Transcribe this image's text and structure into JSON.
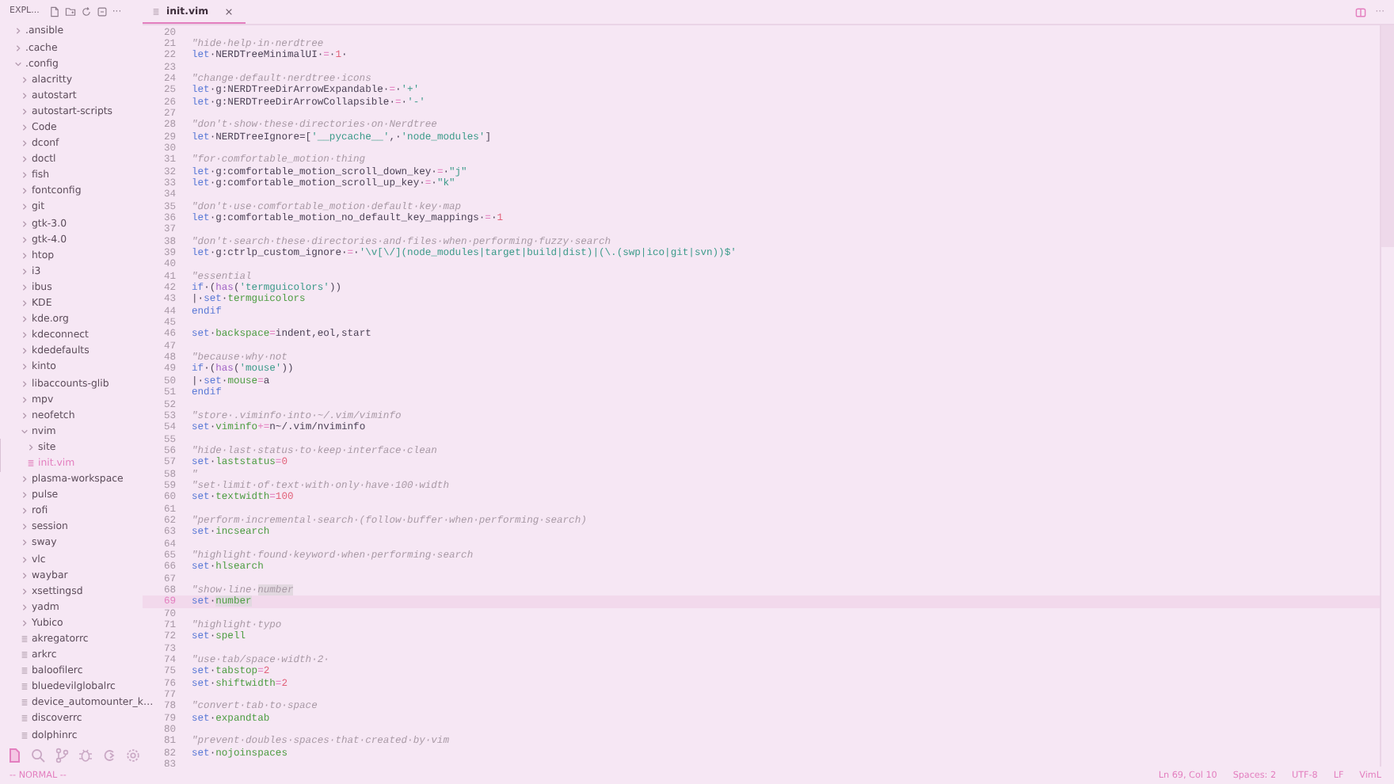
{
  "sidebar": {
    "title": "EXPL...",
    "more": "···",
    "tree": [
      {
        "label": ".ansible",
        "kind": "folder",
        "expanded": false,
        "selected": false
      },
      {
        "label": ".cache",
        "kind": "folder",
        "expanded": false,
        "selected": false
      },
      {
        "label": ".config",
        "kind": "folder",
        "expanded": true,
        "selected": false,
        "children": [
          {
            "label": "alacritty",
            "kind": "folder",
            "expanded": false,
            "selected": false
          },
          {
            "label": "autostart",
            "kind": "folder",
            "expanded": false,
            "selected": false
          },
          {
            "label": "autostart-scripts",
            "kind": "folder",
            "expanded": false,
            "selected": false
          },
          {
            "label": "Code",
            "kind": "folder",
            "expanded": false,
            "selected": false
          },
          {
            "label": "dconf",
            "kind": "folder",
            "expanded": false,
            "selected": false
          },
          {
            "label": "doctl",
            "kind": "folder",
            "expanded": false,
            "selected": false
          },
          {
            "label": "fish",
            "kind": "folder",
            "expanded": false,
            "selected": false
          },
          {
            "label": "fontconfig",
            "kind": "folder",
            "expanded": false,
            "selected": false
          },
          {
            "label": "git",
            "kind": "folder",
            "expanded": false,
            "selected": false
          },
          {
            "label": "gtk-3.0",
            "kind": "folder",
            "expanded": false,
            "selected": false
          },
          {
            "label": "gtk-4.0",
            "kind": "folder",
            "expanded": false,
            "selected": false
          },
          {
            "label": "htop",
            "kind": "folder",
            "expanded": false,
            "selected": false
          },
          {
            "label": "i3",
            "kind": "folder",
            "expanded": false,
            "selected": false
          },
          {
            "label": "ibus",
            "kind": "folder",
            "expanded": false,
            "selected": false
          },
          {
            "label": "KDE",
            "kind": "folder",
            "expanded": false,
            "selected": false
          },
          {
            "label": "kde.org",
            "kind": "folder",
            "expanded": false,
            "selected": false
          },
          {
            "label": "kdeconnect",
            "kind": "folder",
            "expanded": false,
            "selected": false
          },
          {
            "label": "kdedefaults",
            "kind": "folder",
            "expanded": false,
            "selected": false
          },
          {
            "label": "kinto",
            "kind": "folder",
            "expanded": false,
            "selected": false
          },
          {
            "label": "libaccounts-glib",
            "kind": "folder",
            "expanded": false,
            "selected": false
          },
          {
            "label": "mpv",
            "kind": "folder",
            "expanded": false,
            "selected": false
          },
          {
            "label": "neofetch",
            "kind": "folder",
            "expanded": false,
            "selected": false
          },
          {
            "label": "nvim",
            "kind": "folder",
            "expanded": true,
            "selected": false,
            "children": [
              {
                "label": "site",
                "kind": "folder",
                "expanded": false,
                "selected": false
              },
              {
                "label": "init.vim",
                "kind": "file",
                "selected": true
              }
            ]
          },
          {
            "label": "plasma-workspace",
            "kind": "folder",
            "expanded": false,
            "selected": false
          },
          {
            "label": "pulse",
            "kind": "folder",
            "expanded": false,
            "selected": false
          },
          {
            "label": "rofi",
            "kind": "folder",
            "expanded": false,
            "selected": false
          },
          {
            "label": "session",
            "kind": "folder",
            "expanded": false,
            "selected": false
          },
          {
            "label": "sway",
            "kind": "folder",
            "expanded": false,
            "selected": false
          },
          {
            "label": "vlc",
            "kind": "folder",
            "expanded": false,
            "selected": false
          },
          {
            "label": "waybar",
            "kind": "folder",
            "expanded": false,
            "selected": false
          },
          {
            "label": "xsettingsd",
            "kind": "folder",
            "expanded": false,
            "selected": false
          },
          {
            "label": "yadm",
            "kind": "folder",
            "expanded": false,
            "selected": false
          },
          {
            "label": "Yubico",
            "kind": "folder",
            "expanded": false,
            "selected": false
          },
          {
            "label": "akregatorrc",
            "kind": "file",
            "selected": false
          },
          {
            "label": "arkrc",
            "kind": "file",
            "selected": false
          },
          {
            "label": "baloofilerc",
            "kind": "file",
            "selected": false
          },
          {
            "label": "bluedevilglobalrc",
            "kind": "file",
            "selected": false
          },
          {
            "label": "device_automounter_k…",
            "kind": "file",
            "selected": false
          },
          {
            "label": "discoverrc",
            "kind": "file",
            "selected": false
          },
          {
            "label": "dolphinrc",
            "kind": "file",
            "selected": false
          }
        ]
      }
    ],
    "activity_bar": [
      {
        "kind": "files",
        "selected": true
      },
      {
        "kind": "search",
        "selected": false
      },
      {
        "kind": "git",
        "selected": false
      },
      {
        "kind": "debug",
        "selected": false
      },
      {
        "kind": "remote",
        "selected": false
      },
      {
        "kind": "settings",
        "selected": false
      }
    ]
  },
  "editor": {
    "tab": {
      "label": "init.vim",
      "selected": true
    },
    "more": "···",
    "lines": [
      {
        "n": "20",
        "current": false
      },
      {
        "n": "21",
        "current": false,
        "tokens": [
          {
            "kind": "comment",
            "text": "\"hide·help·in·nerdtree"
          }
        ]
      },
      {
        "n": "22",
        "current": false,
        "tokens": [
          {
            "kind": "keyword",
            "text": "let"
          },
          {
            "kind": "plain",
            "text": "·NERDTreeMinimalUI·"
          },
          {
            "kind": "op",
            "text": "="
          },
          {
            "kind": "plain",
            "text": "·"
          },
          {
            "kind": "number",
            "text": "1"
          },
          {
            "kind": "plain",
            "text": "·"
          }
        ]
      },
      {
        "n": "23",
        "current": false
      },
      {
        "n": "24",
        "current": false,
        "tokens": [
          {
            "kind": "comment",
            "text": "\"change·default·nerdtree·icons"
          }
        ]
      },
      {
        "n": "25",
        "current": false,
        "tokens": [
          {
            "kind": "keyword",
            "text": "let"
          },
          {
            "kind": "plain",
            "text": "·g:NERDTreeDirArrowExpandable·"
          },
          {
            "kind": "op",
            "text": "="
          },
          {
            "kind": "plain",
            "text": "·"
          },
          {
            "kind": "string",
            "text": "'+'"
          }
        ]
      },
      {
        "n": "26",
        "current": false,
        "tokens": [
          {
            "kind": "keyword",
            "text": "let"
          },
          {
            "kind": "plain",
            "text": "·g:NERDTreeDirArrowCollapsible·"
          },
          {
            "kind": "op",
            "text": "="
          },
          {
            "kind": "plain",
            "text": "·"
          },
          {
            "kind": "string",
            "text": "'-'"
          }
        ]
      },
      {
        "n": "27",
        "current": false
      },
      {
        "n": "28",
        "current": false,
        "tokens": [
          {
            "kind": "comment",
            "text": "\"don't·show·these·directories·on·Nerdtree"
          }
        ]
      },
      {
        "n": "29",
        "current": false,
        "tokens": [
          {
            "kind": "keyword",
            "text": "let"
          },
          {
            "kind": "plain",
            "text": "·NERDTreeIgnore=["
          },
          {
            "kind": "string",
            "text": "'__pycache__'"
          },
          {
            "kind": "plain",
            "text": ",·"
          },
          {
            "kind": "string",
            "text": "'node_modules'"
          },
          {
            "kind": "plain",
            "text": "]"
          }
        ]
      },
      {
        "n": "30",
        "current": false
      },
      {
        "n": "31",
        "current": false,
        "tokens": [
          {
            "kind": "comment",
            "text": "\"for·comfortable_motion·thing"
          }
        ]
      },
      {
        "n": "32",
        "current": false,
        "tokens": [
          {
            "kind": "keyword",
            "text": "let"
          },
          {
            "kind": "plain",
            "text": "·g:comfortable_motion_scroll_down_key·"
          },
          {
            "kind": "op",
            "text": "="
          },
          {
            "kind": "plain",
            "text": "·"
          },
          {
            "kind": "string",
            "text": "\"j\""
          }
        ]
      },
      {
        "n": "33",
        "current": false,
        "tokens": [
          {
            "kind": "keyword",
            "text": "let"
          },
          {
            "kind": "plain",
            "text": "·g:comfortable_motion_scroll_up_key·"
          },
          {
            "kind": "op",
            "text": "="
          },
          {
            "kind": "plain",
            "text": "·"
          },
          {
            "kind": "string",
            "text": "\"k\""
          }
        ]
      },
      {
        "n": "34",
        "current": false
      },
      {
        "n": "35",
        "current": false,
        "tokens": [
          {
            "kind": "comment",
            "text": "\"don't·use·comfortable_motion·default·key·map"
          }
        ]
      },
      {
        "n": "36",
        "current": false,
        "tokens": [
          {
            "kind": "keyword",
            "text": "let"
          },
          {
            "kind": "plain",
            "text": "·g:comfortable_motion_no_default_key_mappings·"
          },
          {
            "kind": "op",
            "text": "="
          },
          {
            "kind": "plain",
            "text": "·"
          },
          {
            "kind": "number",
            "text": "1"
          }
        ]
      },
      {
        "n": "37",
        "current": false
      },
      {
        "n": "38",
        "current": false,
        "tokens": [
          {
            "kind": "comment",
            "text": "\"don't·search·these·directories·and·files·when·performing·fuzzy·search"
          }
        ]
      },
      {
        "n": "39",
        "current": false,
        "tokens": [
          {
            "kind": "keyword",
            "text": "let"
          },
          {
            "kind": "plain",
            "text": "·g:ctrlp_custom_ignore·"
          },
          {
            "kind": "op",
            "text": "="
          },
          {
            "kind": "plain",
            "text": "·"
          },
          {
            "kind": "string",
            "text": "'\\v[\\/](node_modules|target|build|dist)|(\\.(swp|ico|git|svn))$'"
          }
        ]
      },
      {
        "n": "40",
        "current": false
      },
      {
        "n": "41",
        "current": false,
        "tokens": [
          {
            "kind": "comment",
            "text": "\"essential"
          }
        ]
      },
      {
        "n": "42",
        "current": false,
        "tokens": [
          {
            "kind": "keyword",
            "text": "if"
          },
          {
            "kind": "plain",
            "text": "·("
          },
          {
            "kind": "function",
            "text": "has"
          },
          {
            "kind": "plain",
            "text": "("
          },
          {
            "kind": "string",
            "text": "'termguicolors'"
          },
          {
            "kind": "plain",
            "text": "))"
          }
        ]
      },
      {
        "n": "43",
        "current": false,
        "tokens": [
          {
            "kind": "plain",
            "text": "|·"
          },
          {
            "kind": "keyword",
            "text": "set"
          },
          {
            "kind": "plain",
            "text": "·"
          },
          {
            "kind": "option",
            "text": "termguicolors"
          }
        ]
      },
      {
        "n": "44",
        "current": false,
        "tokens": [
          {
            "kind": "keyword",
            "text": "endif"
          }
        ]
      },
      {
        "n": "45",
        "current": false
      },
      {
        "n": "46",
        "current": false,
        "tokens": [
          {
            "kind": "keyword",
            "text": "set"
          },
          {
            "kind": "plain",
            "text": "·"
          },
          {
            "kind": "option",
            "text": "backspace"
          },
          {
            "kind": "op",
            "text": "="
          },
          {
            "kind": "plain",
            "text": "indent,eol,start"
          }
        ]
      },
      {
        "n": "47",
        "current": false
      },
      {
        "n": "48",
        "current": false,
        "tokens": [
          {
            "kind": "comment",
            "text": "\"because·why·not"
          }
        ]
      },
      {
        "n": "49",
        "current": false,
        "tokens": [
          {
            "kind": "keyword",
            "text": "if"
          },
          {
            "kind": "plain",
            "text": "·("
          },
          {
            "kind": "function",
            "text": "has"
          },
          {
            "kind": "plain",
            "text": "("
          },
          {
            "kind": "string",
            "text": "'mouse'"
          },
          {
            "kind": "plain",
            "text": "))"
          }
        ]
      },
      {
        "n": "50",
        "current": false,
        "tokens": [
          {
            "kind": "plain",
            "text": "|·"
          },
          {
            "kind": "keyword",
            "text": "set"
          },
          {
            "kind": "plain",
            "text": "·"
          },
          {
            "kind": "option",
            "text": "mouse"
          },
          {
            "kind": "op",
            "text": "="
          },
          {
            "kind": "plain",
            "text": "a"
          }
        ]
      },
      {
        "n": "51",
        "current": false,
        "tokens": [
          {
            "kind": "keyword",
            "text": "endif"
          }
        ]
      },
      {
        "n": "52",
        "current": false
      },
      {
        "n": "53",
        "current": false,
        "tokens": [
          {
            "kind": "comment",
            "text": "\"store·.viminfo·into·~/.vim/viminfo"
          }
        ]
      },
      {
        "n": "54",
        "current": false,
        "tokens": [
          {
            "kind": "keyword",
            "text": "set"
          },
          {
            "kind": "plain",
            "text": "·"
          },
          {
            "kind": "option",
            "text": "viminfo"
          },
          {
            "kind": "op",
            "text": "+="
          },
          {
            "kind": "plain",
            "text": "n~/.vim/nviminfo"
          }
        ]
      },
      {
        "n": "55",
        "current": false
      },
      {
        "n": "56",
        "current": false,
        "tokens": [
          {
            "kind": "comment",
            "text": "\"hide·last·status·to·keep·interface·clean"
          }
        ]
      },
      {
        "n": "57",
        "current": false,
        "tokens": [
          {
            "kind": "keyword",
            "text": "set"
          },
          {
            "kind": "plain",
            "text": "·"
          },
          {
            "kind": "option",
            "text": "laststatus"
          },
          {
            "kind": "op",
            "text": "="
          },
          {
            "kind": "number",
            "text": "0"
          }
        ]
      },
      {
        "n": "58",
        "current": false,
        "tokens": [
          {
            "kind": "comment",
            "text": "\""
          }
        ]
      },
      {
        "n": "59",
        "current": false,
        "tokens": [
          {
            "kind": "comment",
            "text": "\"set·limit·of·text·with·only·have·100·width"
          }
        ]
      },
      {
        "n": "60",
        "current": false,
        "tokens": [
          {
            "kind": "keyword",
            "text": "set"
          },
          {
            "kind": "plain",
            "text": "·"
          },
          {
            "kind": "option",
            "text": "textwidth"
          },
          {
            "kind": "op",
            "text": "="
          },
          {
            "kind": "number",
            "text": "100"
          }
        ]
      },
      {
        "n": "61",
        "current": false
      },
      {
        "n": "62",
        "current": false,
        "tokens": [
          {
            "kind": "comment",
            "text": "\"perform·incremental·search·(follow·buffer·when·performing·search)"
          }
        ]
      },
      {
        "n": "63",
        "current": false,
        "tokens": [
          {
            "kind": "keyword",
            "text": "set"
          },
          {
            "kind": "plain",
            "text": "·"
          },
          {
            "kind": "option",
            "text": "incsearch"
          }
        ]
      },
      {
        "n": "64",
        "current": false
      },
      {
        "n": "65",
        "current": false,
        "tokens": [
          {
            "kind": "comment",
            "text": "\"highlight·found·keyword·when·performing·search"
          }
        ]
      },
      {
        "n": "66",
        "current": false,
        "tokens": [
          {
            "kind": "keyword",
            "text": "set"
          },
          {
            "kind": "plain",
            "text": "·"
          },
          {
            "kind": "option",
            "text": "hlsearch"
          }
        ]
      },
      {
        "n": "67",
        "current": false
      },
      {
        "n": "68",
        "current": false,
        "tokens": [
          {
            "kind": "comment",
            "text": "\"show·line·"
          },
          {
            "kind": "comment-match",
            "text": "number"
          }
        ]
      },
      {
        "n": "69",
        "current": true,
        "tokens": [
          {
            "kind": "keyword",
            "text": "set"
          },
          {
            "kind": "plain",
            "text": "·"
          },
          {
            "kind": "option-match",
            "text": "number"
          }
        ]
      },
      {
        "n": "70",
        "current": false
      },
      {
        "n": "71",
        "current": false,
        "tokens": [
          {
            "kind": "comment",
            "text": "\"highlight·typo"
          }
        ]
      },
      {
        "n": "72",
        "current": false,
        "tokens": [
          {
            "kind": "keyword",
            "text": "set"
          },
          {
            "kind": "plain",
            "text": "·"
          },
          {
            "kind": "option",
            "text": "spell"
          }
        ]
      },
      {
        "n": "73",
        "current": false
      },
      {
        "n": "74",
        "current": false,
        "tokens": [
          {
            "kind": "comment",
            "text": "\"use·tab/space·width·2·"
          }
        ]
      },
      {
        "n": "75",
        "current": false,
        "tokens": [
          {
            "kind": "keyword",
            "text": "set"
          },
          {
            "kind": "plain",
            "text": "·"
          },
          {
            "kind": "option",
            "text": "tabstop"
          },
          {
            "kind": "op",
            "text": "="
          },
          {
            "kind": "number",
            "text": "2"
          }
        ]
      },
      {
        "n": "76",
        "current": false,
        "tokens": [
          {
            "kind": "keyword",
            "text": "set"
          },
          {
            "kind": "plain",
            "text": "·"
          },
          {
            "kind": "option",
            "text": "shiftwidth"
          },
          {
            "kind": "op",
            "text": "="
          },
          {
            "kind": "number",
            "text": "2"
          }
        ]
      },
      {
        "n": "77",
        "current": false
      },
      {
        "n": "78",
        "current": false,
        "tokens": [
          {
            "kind": "comment",
            "text": "\"convert·tab·to·space"
          }
        ]
      },
      {
        "n": "79",
        "current": false,
        "tokens": [
          {
            "kind": "keyword",
            "text": "set"
          },
          {
            "kind": "plain",
            "text": "·"
          },
          {
            "kind": "option",
            "text": "expandtab"
          }
        ]
      },
      {
        "n": "80",
        "current": false
      },
      {
        "n": "81",
        "current": false,
        "tokens": [
          {
            "kind": "comment",
            "text": "\"prevent·doubles·spaces·that·created·by·vim"
          }
        ]
      },
      {
        "n": "82",
        "current": false,
        "tokens": [
          {
            "kind": "keyword",
            "text": "set"
          },
          {
            "kind": "plain",
            "text": "·"
          },
          {
            "kind": "option",
            "text": "nojoinspaces"
          }
        ]
      },
      {
        "n": "83",
        "current": false
      }
    ]
  },
  "status_bar": {
    "mode": "-- NORMAL --",
    "items": [
      "Ln 69, Col 10",
      "Spaces: 2",
      "UTF-8",
      "LF",
      "VimL"
    ]
  }
}
